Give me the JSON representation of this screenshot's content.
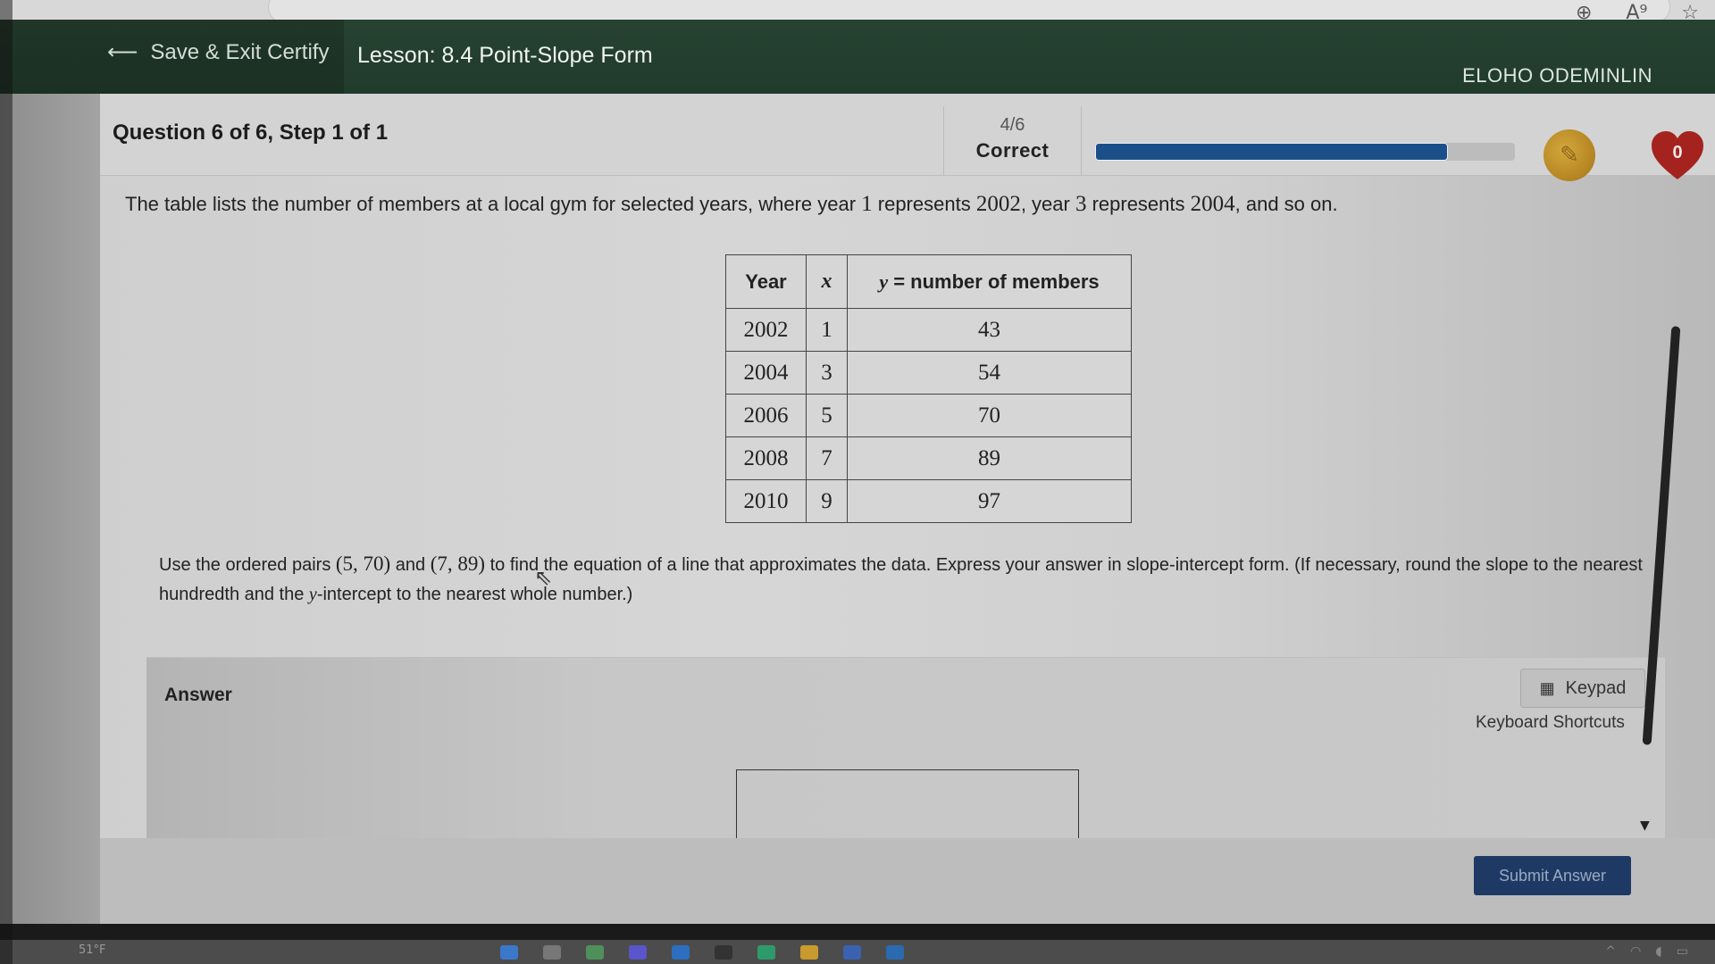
{
  "browser": {
    "icons": [
      "zoom-in-icon",
      "read-aloud-icon",
      "favorite-star-icon"
    ]
  },
  "header": {
    "save_exit_label": "Save & Exit Certify",
    "lesson_title": "Lesson: 8.4 Point-Slope Form",
    "user_name": "ELOHO ODEMINLIN"
  },
  "status": {
    "question_label": "Question 6 of 6, Step 1 of 1",
    "score_fraction": "4/6",
    "score_label": "Correct",
    "progress_percent": 84,
    "hearts_count": "0",
    "accent_color": "#1b4f8a",
    "header_color": "#254030"
  },
  "problem": {
    "intro_parts": [
      "The table lists the number of members at a local gym for selected years, where year ",
      "1",
      " represents ",
      "2002",
      ", year ",
      "3",
      " represents ",
      "2004",
      ", and so on."
    ],
    "table": {
      "headers": [
        "Year",
        "x",
        "y",
        "= number of members"
      ],
      "rows": [
        {
          "year": "2002",
          "x": "1",
          "y": "43"
        },
        {
          "year": "2004",
          "x": "3",
          "y": "54"
        },
        {
          "year": "2006",
          "x": "5",
          "y": "70"
        },
        {
          "year": "2008",
          "x": "7",
          "y": "89"
        },
        {
          "year": "2010",
          "x": "9",
          "y": "97"
        }
      ]
    },
    "prompt_parts": [
      "Use the ordered pairs ",
      "(5, 70)",
      " and ",
      "(7, 89)",
      " to find the equation of a line that approximates the data. Express your answer in slope-intercept form. (If necessary, round the slope to the nearest hundredth and the ",
      "y",
      "-intercept to the nearest whole number.)"
    ]
  },
  "answer": {
    "label": "Answer",
    "keypad_label": "Keypad",
    "shortcuts_label": "Keyboard Shortcuts",
    "input_value": "",
    "submit_label": "Submit Answer"
  },
  "taskbar": {
    "weather": "51°F"
  }
}
